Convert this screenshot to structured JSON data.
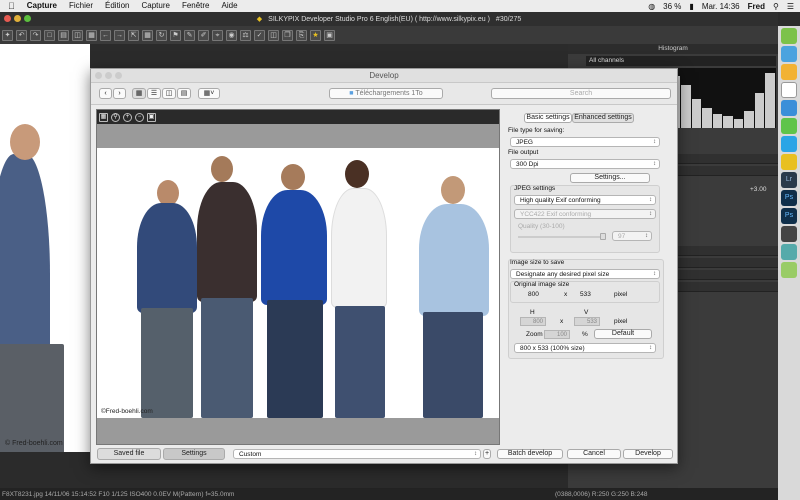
{
  "menubar": {
    "app": "Capture",
    "items": [
      "Fichier",
      "Édition",
      "Capture",
      "Fenêtre",
      "Aide"
    ],
    "battery": "36 %",
    "clock": "Mar. 14:36",
    "user": "Fred"
  },
  "app": {
    "title": "SILKYPIX Developer Studio Pro 6 English(EU) ( http://www.silkypix.eu )",
    "counter": "#30/275"
  },
  "left_watermark": "© Fred-boehli.com",
  "right_panel": {
    "histogram_title": "Histogram",
    "channels": "All channels",
    "exposure_value": "+3.00",
    "histogram_bars": [
      0.35,
      0.5,
      0.42,
      0.6,
      0.8,
      0.7,
      0.55,
      0.65,
      0.9,
      0.75,
      0.5,
      0.35,
      0.25,
      0.2,
      0.15,
      0.3,
      0.6,
      0.95
    ]
  },
  "status": {
    "left": "F8XT8231.jpg 14/11/06 15:14:52 F10 1/125 ISO400  0.0EV M(Pattern) f=35.0mm",
    "right": "(0388,0006) R:250 G:250 B:248"
  },
  "dialog": {
    "title": "Develop",
    "path": "Téléchargements 1To",
    "search_placeholder": "Search",
    "tabs": {
      "basic": "Basic settings",
      "enhanced": "Enhanced settings"
    },
    "file_type_label": "File type for saving:",
    "file_type": "JPEG",
    "file_output_label": "File output",
    "file_output": "300 Dpi",
    "settings_btn": "Settings...",
    "jpeg_settings_label": "JPEG settings",
    "jpeg_quality_mode": "High quality Exif conforming",
    "jpeg_color_mode": "YCC422 Exif conforming",
    "quality_label": "Quality (30-100)",
    "quality_value": "97",
    "image_size_label": "Image size to save",
    "image_size_mode": "Designate any desired pixel size",
    "original_size_label": "Original image size",
    "orig_w": "800",
    "x": "x",
    "orig_h": "533",
    "pixel": "pixel",
    "h_label": "H",
    "v_label": "V",
    "h_value": "800",
    "v_value": "533",
    "zoom_label": "Zoom",
    "zoom_value": "100",
    "percent": "%",
    "default_btn": "Default",
    "size_summary": "800 x  533 (100% size)",
    "photo_watermark": "©Fred-boehli.com",
    "saved_file_btn": "Saved file",
    "settings_tab_btn": "Settings",
    "preset": "Custom",
    "plus": "+",
    "batch_btn": "Batch develop",
    "cancel_btn": "Cancel",
    "develop_btn": "Develop"
  }
}
